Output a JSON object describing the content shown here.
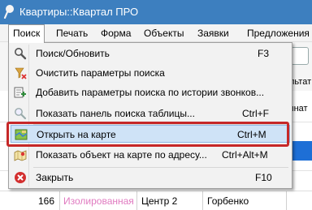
{
  "window": {
    "title": "Квартиры::Квартал ПРО"
  },
  "menubar": {
    "items": [
      {
        "label": "Поиск"
      },
      {
        "label": "Печать"
      },
      {
        "label": "Форма"
      },
      {
        "label": "Объекты"
      },
      {
        "label": "Заявки"
      },
      {
        "label": "Предложения"
      }
    ]
  },
  "search_menu": {
    "items": [
      {
        "label": "Поиск/Обновить",
        "shortcut": "F3",
        "icon": "magnifier-icon"
      },
      {
        "label": "Очистить параметры поиска",
        "shortcut": "",
        "icon": "clear-filter-icon"
      },
      {
        "label": "Добавить параметры поиска по истории звонков...",
        "shortcut": "",
        "icon": "call-history-icon"
      },
      {
        "label": "Показать панель поиска таблицы...",
        "shortcut": "Ctrl+F",
        "icon": "table-search-icon"
      },
      {
        "label": "Открыть на карте",
        "shortcut": "Ctrl+M",
        "icon": "map-icon",
        "highlighted": true
      },
      {
        "label": "Показать объект на карте по адресу...",
        "shortcut": "Ctrl+Alt+M",
        "icon": "map-pin-icon"
      },
      {
        "label": "Закрыть",
        "shortcut": "F10",
        "icon": "close-icon"
      }
    ]
  },
  "background": {
    "column_header_1": "льтат",
    "column_header_2": "мнат",
    "grid_row": {
      "number": "166",
      "type": "Изолированная",
      "district": "Центр 2",
      "street": "Горбенко"
    }
  },
  "colors": {
    "titlebar": "#3d7fbf",
    "highlight": "#cfe3f7",
    "annotation_frame": "#c62828",
    "type_text": "#e07ac0"
  }
}
